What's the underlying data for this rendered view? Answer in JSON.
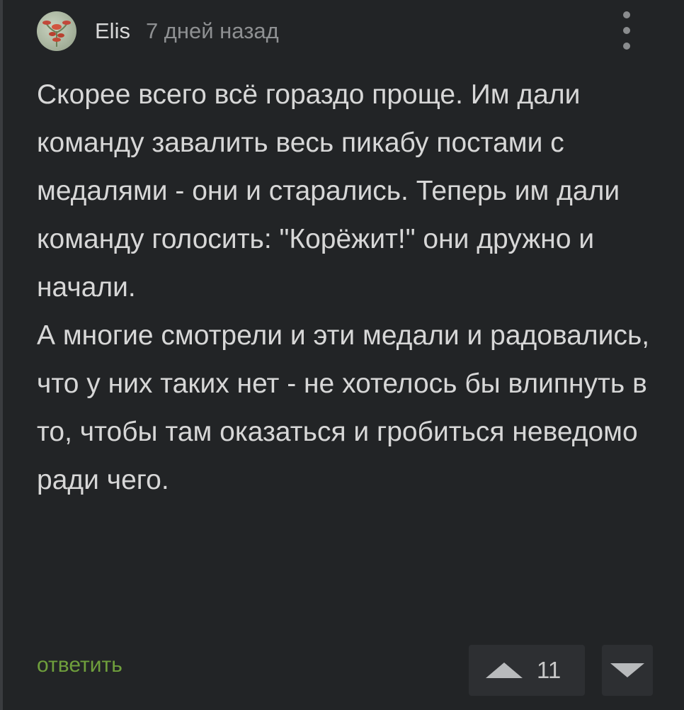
{
  "comment": {
    "author": "Elis",
    "timestamp": "7 дней назад",
    "paragraphs": [
      "Скорее всего всё гораздо проще. Им дали команду завалить весь пикабу постами с медалями - они и старались. Теперь им дали команду голосить: \"Корёжит!\" они дружно и начали.",
      "А многие смотрели и эти медали и радовались, что у них таких нет - не хотелось бы влипнуть в то, чтобы там оказаться и гробиться неведомо ради чего."
    ],
    "reply_label": "ответить",
    "rating": "11"
  },
  "icons": {
    "avatar": "avatar-image",
    "menu": "more-vertical-icon",
    "upvote": "triangle-up-icon",
    "downvote": "triangle-down-icon"
  },
  "colors": {
    "background": "#222426",
    "text": "#d7d7d7",
    "muted": "#8e9092",
    "reply": "#6f9f3c",
    "button_bg": "#2d2f32"
  }
}
